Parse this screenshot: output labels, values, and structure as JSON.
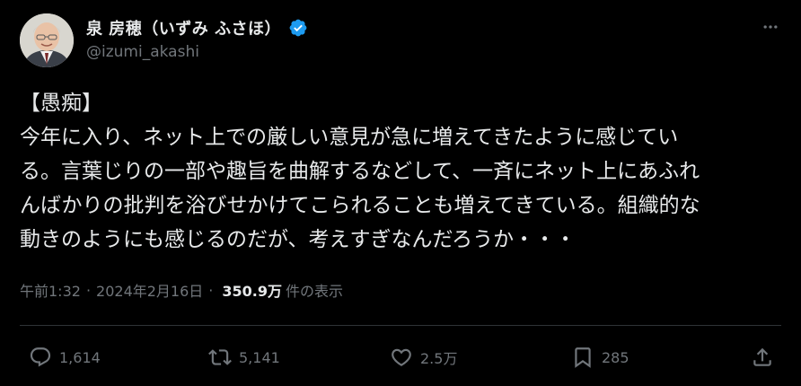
{
  "author": {
    "display_name": "泉 房穂（いずみ ふさほ）",
    "handle": "@izumi_akashi",
    "verified": true
  },
  "post": {
    "lines": [
      "【愚痴】",
      "今年に入り、ネット上での厳しい意見が急に増えてきたように感じてい",
      "る。言葉じりの一部や趣旨を曲解するなどして、一斉にネット上にあふれ",
      "んばかりの批判を浴びせかけてこられることも増えてきている。組織的な",
      "動きのようにも感じるのだが、考えすぎなんだろうか・・・"
    ]
  },
  "meta": {
    "time": "午前1:32",
    "separator": "·",
    "date": "2024年2月16日",
    "views": "350.9万",
    "views_label": "件の表示"
  },
  "actions": {
    "replies": "1,614",
    "reposts": "5,141",
    "likes": "2.5万",
    "bookmarks": "285"
  },
  "icons": {
    "more": "more-dots-icon",
    "verified": "verified-badge-icon",
    "reply": "reply-icon",
    "repost": "repost-icon",
    "like": "heart-icon",
    "bookmark": "bookmark-icon",
    "share": "share-icon"
  },
  "colors": {
    "background": "#000000",
    "text": "#e7e9ea",
    "secondary": "#71767b",
    "verified": "#1d9bf0",
    "divider": "#2f3336"
  }
}
